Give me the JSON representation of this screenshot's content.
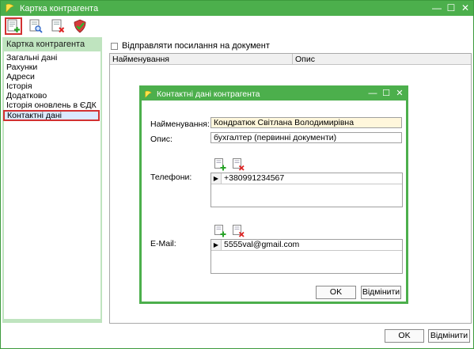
{
  "window": {
    "title": "Картка контрагента",
    "controls": {
      "minimize": "—",
      "maximize": "☐",
      "close": "✕"
    }
  },
  "toolbar": {
    "buttons": [
      {
        "name": "add",
        "icon": "add-document-icon"
      },
      {
        "name": "view",
        "icon": "view-document-icon"
      },
      {
        "name": "delete",
        "icon": "delete-document-icon"
      },
      {
        "name": "security",
        "icon": "shield-check-icon"
      }
    ]
  },
  "sidebar": {
    "header": "Картка контрагента",
    "items": [
      {
        "label": "Загальні дані"
      },
      {
        "label": "Рахунки"
      },
      {
        "label": "Адреси"
      },
      {
        "label": "Історія"
      },
      {
        "label": "Додатково"
      },
      {
        "label": "Історія оновлень в ЄДК"
      },
      {
        "label": "Контактні дані"
      }
    ],
    "selected_index": 6
  },
  "main": {
    "checkbox_label": "Відправляти посилання на документ",
    "checkbox_checked": false,
    "grid_columns": [
      "Найменування",
      "Опис"
    ]
  },
  "dialog": {
    "title": "Контактні дані контрагента",
    "controls": {
      "minimize": "—",
      "maximize": "☐",
      "close": "✕"
    },
    "name_label": "Найменування:",
    "name_value": "Кондратюк Світлана Володимирівна",
    "desc_label": "Опис:",
    "desc_value": "бухгалтер (первинні документи)",
    "phones_label": "Телефони:",
    "phones": [
      "+380991234567"
    ],
    "email_label": "E-Mail:",
    "emails": [
      "5555val@gmail.com"
    ],
    "ok_label": "OK",
    "cancel_label": "Відмінити"
  },
  "footer": {
    "ok_label": "OK",
    "cancel_label": "Відмінити"
  },
  "colors": {
    "titlebar": "#4caf4c",
    "panel": "#bfe4bf",
    "highlight": "#d23131"
  }
}
